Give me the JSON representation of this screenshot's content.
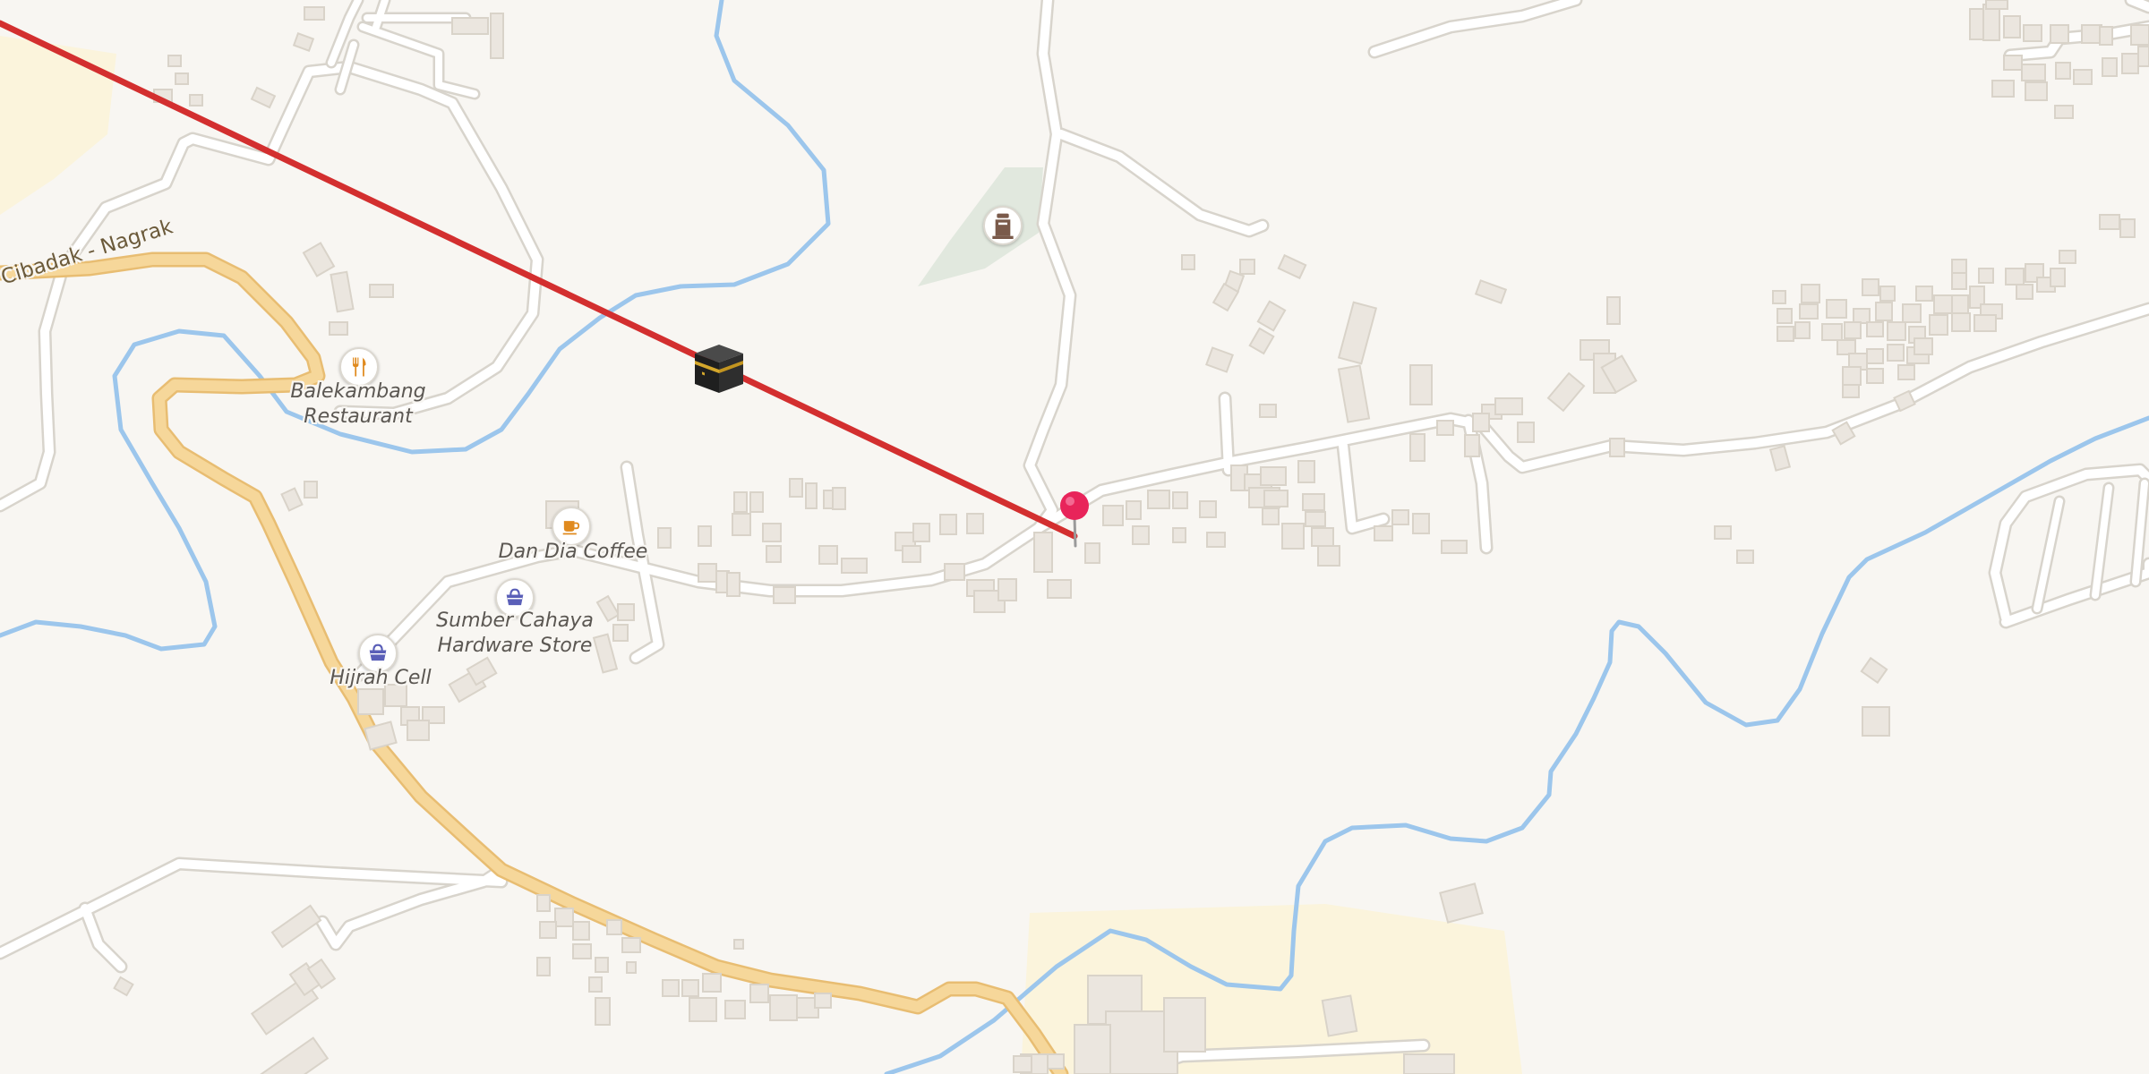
{
  "map": {
    "road_labels": [
      {
        "id": "cibadak-nagrak",
        "text": "Cibadak - Nagrak"
      }
    ],
    "pois": [
      {
        "id": "balekambang",
        "name": "Balekambang\nRestaurant",
        "icon": "restaurant-icon",
        "icon_color": "#e08a1e"
      },
      {
        "id": "dan-dia",
        "name": "Dan Dia Coffee",
        "icon": "coffee-icon",
        "icon_color": "#e08a1e"
      },
      {
        "id": "sumber-cahaya",
        "name": "Sumber Cahaya\nHardware Store",
        "icon": "shopping-basket-icon",
        "icon_color": "#5a5fb8"
      },
      {
        "id": "hijrah-cell",
        "name": "Hijrah Cell",
        "icon": "shopping-basket-icon",
        "icon_color": "#5a5fb8"
      },
      {
        "id": "cemetery",
        "name": "",
        "icon": "monument-icon",
        "icon_color": "#7a5a4a"
      }
    ],
    "markers": {
      "location_pin": {
        "icon": "map-pin-icon",
        "color": "#e8245a"
      },
      "qibla_marker": {
        "icon": "kaaba-icon"
      },
      "qibla_line": {
        "color": "#d32f2f"
      }
    },
    "colors": {
      "background": "#f8f6f2",
      "main_road": "#f6d79a",
      "main_road_casing": "#e8bd72",
      "minor_road": "#ffffff",
      "minor_road_casing": "#d8d4cc",
      "river": "#9cc6ec",
      "building": "#ebe6df",
      "building_edge": "#d9d3c9",
      "green_area": "#e1e8de",
      "landuse_yellow": "#fbf4dc"
    }
  }
}
